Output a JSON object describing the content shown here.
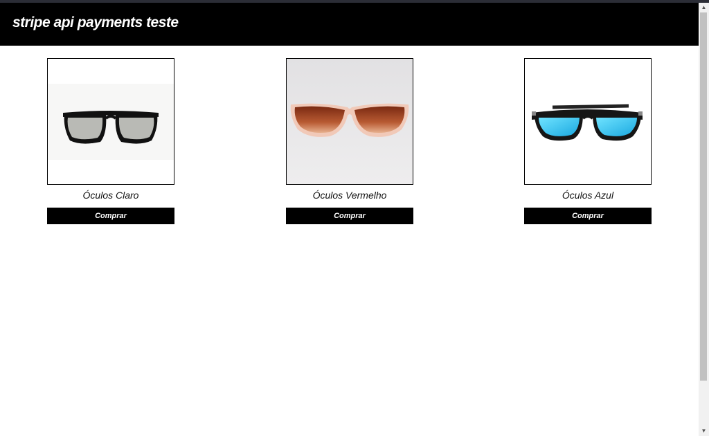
{
  "header": {
    "title": "stripe api payments teste"
  },
  "products": [
    {
      "name": "Óculos Claro",
      "button_label": "Comprar",
      "image_icon": "sunglasses-clear-icon"
    },
    {
      "name": "Óculos Vermelho",
      "button_label": "Comprar",
      "image_icon": "sunglasses-red-icon"
    },
    {
      "name": "Óculos Azul",
      "button_label": "Comprar",
      "image_icon": "sunglasses-blue-icon"
    }
  ],
  "colors": {
    "header_bg": "#000000",
    "button_bg": "#000000",
    "text": "#ffffff",
    "lens_clear": "#b9bab5",
    "lens_red": "#b0502a",
    "lens_blue": "#2ec8f0"
  },
  "scrollbar": {
    "up_icon": "triangle-up-icon",
    "down_icon": "triangle-down-icon"
  }
}
